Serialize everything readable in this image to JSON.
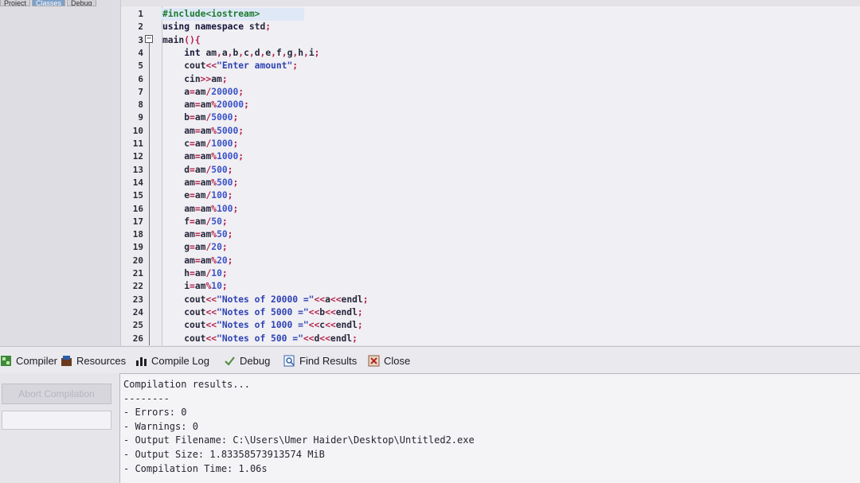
{
  "left_panel": {
    "tabs": [
      "Project",
      "Classes",
      "Debug"
    ]
  },
  "editor": {
    "lines": [
      {
        "n": "1",
        "html": "<span class='pp'>#include&lt;iostream&gt;</span>"
      },
      {
        "n": "2",
        "html": "<span class='kw'>using namespace</span> <span class='id'>std</span><span class='op'>;</span>"
      },
      {
        "n": "3",
        "html": "<span class='id'>main</span><span class='op'>(){</span>"
      },
      {
        "n": "4",
        "html": "    <span class='kw'>int</span> <span class='id'>am</span><span class='op'>,</span><span class='id'>a</span><span class='op'>,</span><span class='id'>b</span><span class='op'>,</span><span class='id'>c</span><span class='op'>,</span><span class='id'>d</span><span class='op'>,</span><span class='id'>e</span><span class='op'>,</span><span class='id'>f</span><span class='op'>,</span><span class='id'>g</span><span class='op'>,</span><span class='id'>h</span><span class='op'>,</span><span class='id'>i</span><span class='op'>;</span>"
      },
      {
        "n": "5",
        "html": "    <span class='id'>cout</span><span class='op'>&lt;&lt;</span><span class='str'>\"Enter amount\"</span><span class='op'>;</span>"
      },
      {
        "n": "6",
        "html": "    <span class='id'>cin</span><span class='op'>&gt;&gt;</span><span class='id'>am</span><span class='op'>;</span>"
      },
      {
        "n": "7",
        "html": "    <span class='id'>a</span><span class='op'>=</span><span class='id'>am</span><span class='op'>/</span><span class='num'>20000</span><span class='op'>;</span>"
      },
      {
        "n": "8",
        "html": "    <span class='id'>am</span><span class='op'>=</span><span class='id'>am</span><span class='op'>%</span><span class='num'>20000</span><span class='op'>;</span>"
      },
      {
        "n": "9",
        "html": "    <span class='id'>b</span><span class='op'>=</span><span class='id'>am</span><span class='op'>/</span><span class='num'>5000</span><span class='op'>;</span>"
      },
      {
        "n": "10",
        "html": "    <span class='id'>am</span><span class='op'>=</span><span class='id'>am</span><span class='op'>%</span><span class='num'>5000</span><span class='op'>;</span>"
      },
      {
        "n": "11",
        "html": "    <span class='id'>c</span><span class='op'>=</span><span class='id'>am</span><span class='op'>/</span><span class='num'>1000</span><span class='op'>;</span>"
      },
      {
        "n": "12",
        "html": "    <span class='id'>am</span><span class='op'>=</span><span class='id'>am</span><span class='op'>%</span><span class='num'>1000</span><span class='op'>;</span>"
      },
      {
        "n": "13",
        "html": "    <span class='id'>d</span><span class='op'>=</span><span class='id'>am</span><span class='op'>/</span><span class='num'>500</span><span class='op'>;</span>"
      },
      {
        "n": "14",
        "html": "    <span class='id'>am</span><span class='op'>=</span><span class='id'>am</span><span class='op'>%</span><span class='num'>500</span><span class='op'>;</span>"
      },
      {
        "n": "15",
        "html": "    <span class='id'>e</span><span class='op'>=</span><span class='id'>am</span><span class='op'>/</span><span class='num'>100</span><span class='op'>;</span>"
      },
      {
        "n": "16",
        "html": "    <span class='id'>am</span><span class='op'>=</span><span class='id'>am</span><span class='op'>%</span><span class='num'>100</span><span class='op'>;</span>"
      },
      {
        "n": "17",
        "html": "    <span class='id'>f</span><span class='op'>=</span><span class='id'>am</span><span class='op'>/</span><span class='num'>50</span><span class='op'>;</span>"
      },
      {
        "n": "18",
        "html": "    <span class='id'>am</span><span class='op'>=</span><span class='id'>am</span><span class='op'>%</span><span class='num'>50</span><span class='op'>;</span>"
      },
      {
        "n": "19",
        "html": "    <span class='id'>g</span><span class='op'>=</span><span class='id'>am</span><span class='op'>/</span><span class='num'>20</span><span class='op'>;</span>"
      },
      {
        "n": "20",
        "html": "    <span class='id'>am</span><span class='op'>=</span><span class='id'>am</span><span class='op'>%</span><span class='num'>20</span><span class='op'>;</span>"
      },
      {
        "n": "21",
        "html": "    <span class='id'>h</span><span class='op'>=</span><span class='id'>am</span><span class='op'>/</span><span class='num'>10</span><span class='op'>;</span>"
      },
      {
        "n": "22",
        "html": "    <span class='id'>i</span><span class='op'>=</span><span class='id'>am</span><span class='op'>%</span><span class='num'>10</span><span class='op'>;</span>"
      },
      {
        "n": "23",
        "html": "    <span class='id'>cout</span><span class='op'>&lt;&lt;</span><span class='str'>\"Notes of 20000 =\"</span><span class='op'>&lt;&lt;</span><span class='id'>a</span><span class='op'>&lt;&lt;</span><span class='id'>endl</span><span class='op'>;</span>"
      },
      {
        "n": "24",
        "html": "    <span class='id'>cout</span><span class='op'>&lt;&lt;</span><span class='str'>\"Notes of 5000 =\"</span><span class='op'>&lt;&lt;</span><span class='id'>b</span><span class='op'>&lt;&lt;</span><span class='id'>endl</span><span class='op'>;</span>"
      },
      {
        "n": "25",
        "html": "    <span class='id'>cout</span><span class='op'>&lt;&lt;</span><span class='str'>\"Notes of 1000 =\"</span><span class='op'>&lt;&lt;</span><span class='id'>c</span><span class='op'>&lt;&lt;</span><span class='id'>endl</span><span class='op'>;</span>"
      },
      {
        "n": "26",
        "html": "    <span class='id'>cout</span><span class='op'>&lt;&lt;</span><span class='str'>\"Notes of 500 =\"</span><span class='op'>&lt;&lt;</span><span class='id'>d</span><span class='op'>&lt;&lt;</span><span class='id'>endl</span><span class='op'>;</span>"
      }
    ]
  },
  "bottom_tabs": {
    "compiler": "Compiler",
    "resources": "Resources",
    "compile_log": "Compile Log",
    "debug": "Debug",
    "find_results": "Find Results",
    "close": "Close"
  },
  "compile_panel": {
    "abort_label": "Abort Compilation",
    "output_lines": [
      "Compilation results...",
      "--------",
      "- Errors: 0",
      "- Warnings: 0",
      "- Output Filename: C:\\Users\\Umer Haider\\Desktop\\Untitled2.exe",
      "- Output Size: 1.83358573913574 MiB",
      "- Compilation Time: 1.06s"
    ]
  }
}
